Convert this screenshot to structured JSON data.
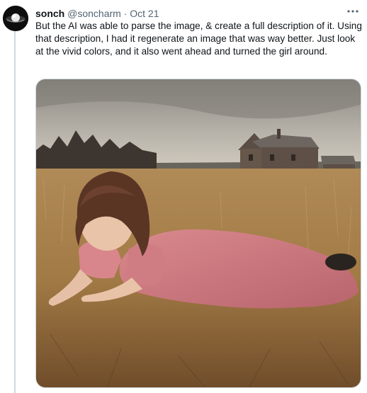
{
  "tweet": {
    "display_name": "sonch",
    "handle": "@soncharm",
    "separator": "·",
    "date": "Oct 21",
    "more_icon": "more-horizontal-icon",
    "text": "But the AI was able to parse the image, & create a full description of it. Using that description, I had it regenerate an image that was way better. Just look at the vivid colors, and it also went ahead and turned the girl around."
  },
  "colors": {
    "text_primary": "#0f1419",
    "text_secondary": "#536471",
    "border": "#cfd9de"
  }
}
